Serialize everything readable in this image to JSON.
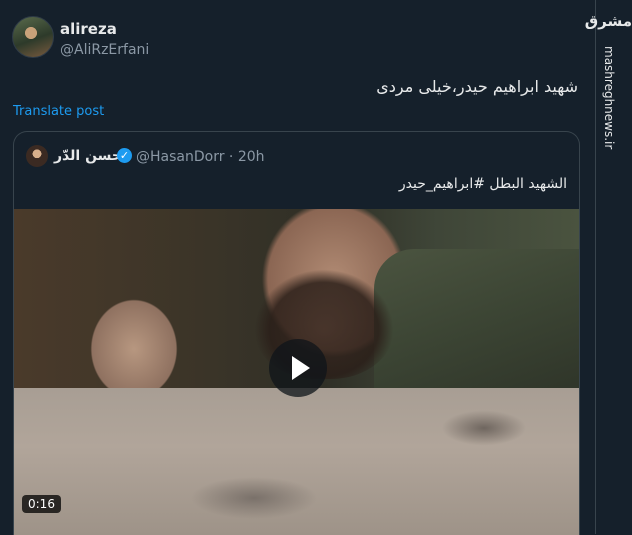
{
  "tweet": {
    "name": "alireza",
    "handle": "@AliRzErfani",
    "text": "شهید ابراهیم حیدر،خیلی مردی",
    "translate_label": "Translate post"
  },
  "quote": {
    "name": "حسن الدّر",
    "handle_time": "@HasanDorr · 20h",
    "text": "الشهيد البطل #ابراهيم_حيدر",
    "video_duration": "0:16"
  },
  "watermark": {
    "logo": "مشرق",
    "url": "mashreghnews.ir"
  }
}
